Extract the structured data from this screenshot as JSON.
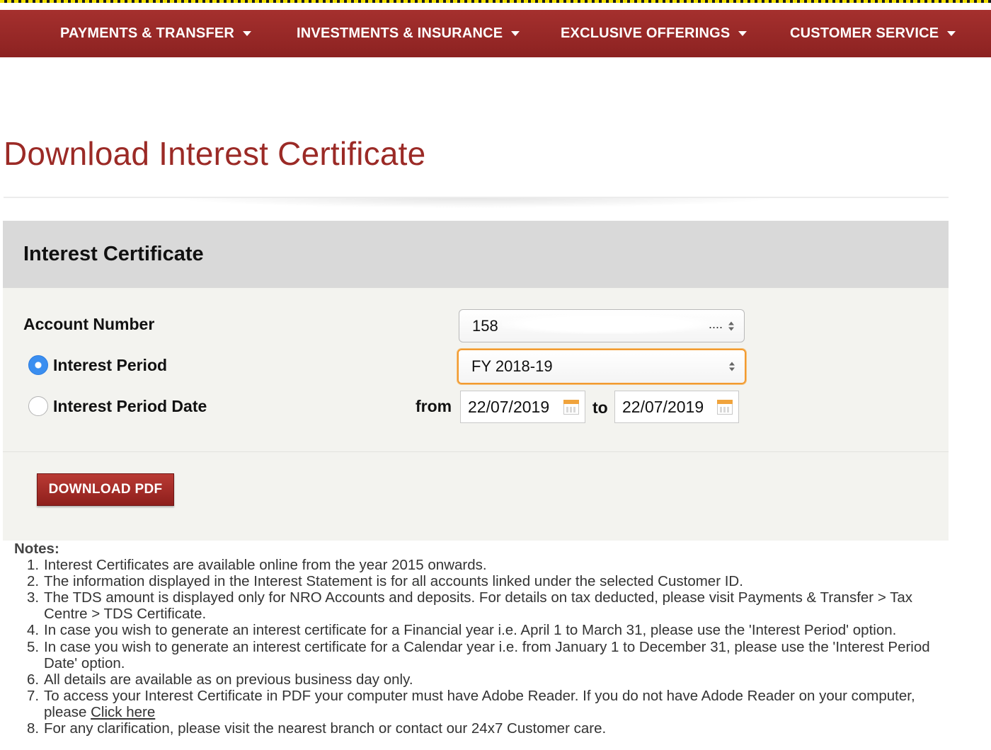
{
  "nav": {
    "items": [
      {
        "label": "PAYMENTS & TRANSFER"
      },
      {
        "label": "INVESTMENTS & INSURANCE"
      },
      {
        "label": "EXCLUSIVE OFFERINGS"
      },
      {
        "label": "CUSTOMER SERVICE"
      }
    ]
  },
  "page": {
    "title": "Download Interest Certificate"
  },
  "panel": {
    "heading": "Interest Certificate",
    "account_label": "Account Number",
    "account_value": "158",
    "account_ellipsis": "....",
    "interest_period_label": "Interest Period",
    "interest_period_selected": true,
    "interest_period_value": "FY 2018-19",
    "interest_period_date_label": "Interest Period Date",
    "interest_period_date_selected": false,
    "from_label": "from",
    "from_value": "22/07/2019",
    "to_label": "to",
    "to_value": "22/07/2019",
    "download_label": "DOWNLOAD PDF"
  },
  "notes": {
    "title": "Notes:",
    "items": [
      "Interest Certificates are available online from the year 2015 onwards.",
      "The information displayed in the Interest Statement is for all accounts linked under the selected Customer ID.",
      "The TDS amount is displayed only for NRO Accounts and deposits. For details on tax deducted, please visit Payments & Transfer > Tax Centre > TDS Certificate.",
      "In case you wish to generate an interest certificate for a Financial year i.e. April 1 to March 31, please use the 'Interest Period' option.",
      "In case you wish to generate an interest certificate for a Calendar year i.e. from January 1 to December 31, please use the 'Interest Period Date' option.",
      "All details are available as on previous business day only.",
      "To access your Interest Certificate in PDF your computer must have Adobe Reader. If you do not have Adode Reader on your computer, please",
      "For any clarification, please visit the nearest branch or contact our 24x7 Customer care."
    ],
    "item7_link": "Click here"
  },
  "colors": {
    "brand_red": "#9b2a26",
    "nav_bg": "#8c2221",
    "focus_orange": "#f29a30",
    "radio_blue": "#3a8ef0"
  }
}
